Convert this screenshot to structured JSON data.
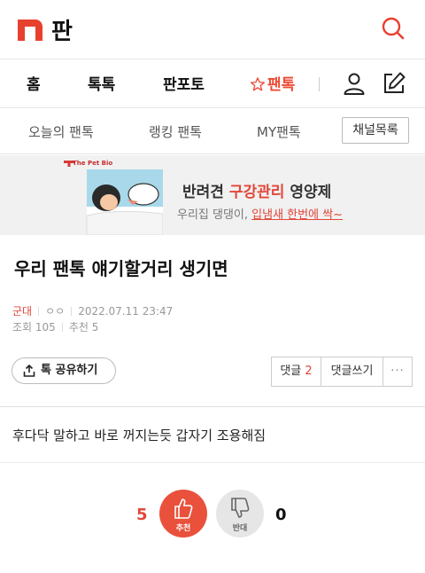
{
  "header": {
    "app_title": "판"
  },
  "main_nav": {
    "items": [
      "홈",
      "톡톡",
      "판포토",
      "팬톡"
    ],
    "active": "팬톡"
  },
  "sub_nav": {
    "items": [
      "오늘의 팬톡",
      "랭킹 팬톡",
      "MY팬톡"
    ],
    "channel_button": "채널목록"
  },
  "banner": {
    "brand": "The Pet Bio",
    "title_part1": "반려견 ",
    "title_highlight": "구강관리",
    "title_part2": " 영양제",
    "sub_part1": "우리집 댕댕이, ",
    "sub_highlight": "입냄새 한번에 싹~"
  },
  "post": {
    "title": "우리 팬톡 얘기할거리 생기면",
    "channel": "군대",
    "author": "ㅇㅇ",
    "datetime": "2022.07.11 23:47",
    "views_label": "조회 105",
    "recommend_label": "추천 5",
    "share_label": "톡 공유하기",
    "reply_label": "댓글",
    "reply_count": "2",
    "write_reply_label": "댓글쓰기",
    "more_label": "···",
    "body": "후다닥 말하고 바로 꺼지는듯 갑자기 조용해짐"
  },
  "votes": {
    "up_count": "5",
    "up_label": "추천",
    "down_count": "0",
    "down_label": "반대"
  },
  "colors": {
    "accent": "#ee4b36",
    "vote_up": "#e9513c",
    "vote_down": "#e6e6e6"
  }
}
